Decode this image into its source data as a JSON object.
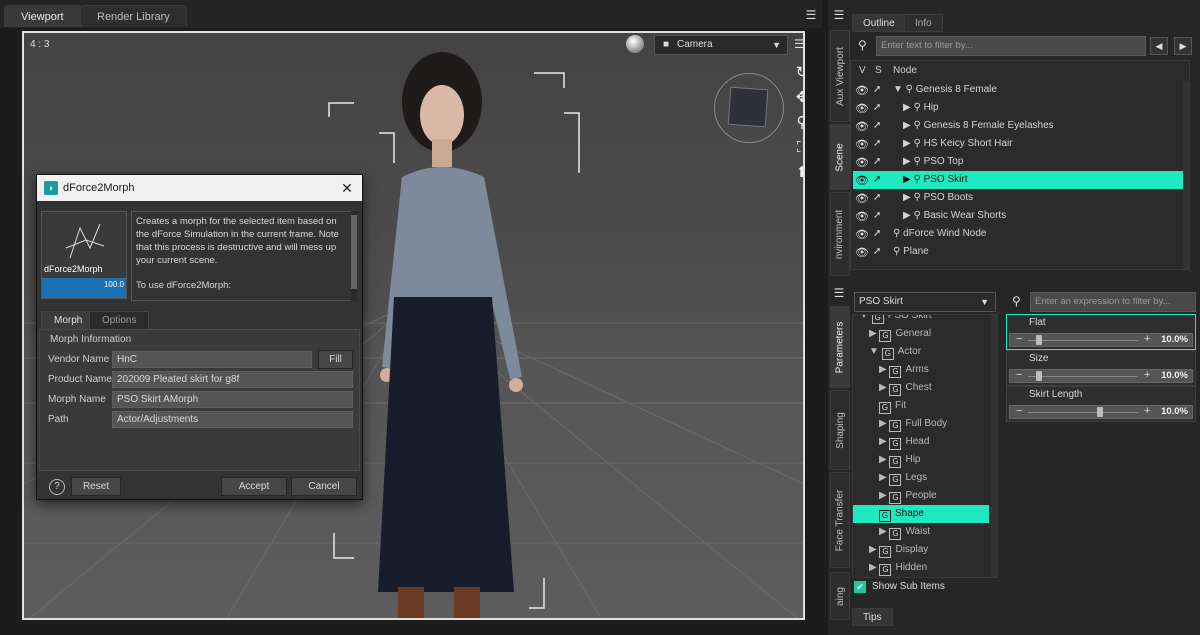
{
  "tabs": {
    "viewport": "Viewport",
    "render_library": "Render Library"
  },
  "viewport": {
    "aspect": "4 : 3",
    "camera": "Camera"
  },
  "dialog": {
    "title": "dForce2Morph",
    "thumb_label": "dForce2Morph",
    "thumb_value": "100.0",
    "description": [
      "Creates a morph for the selected item based on the dForce Simulation in the current frame. Note that this process is destructive and will mess up your current scene.",
      "To use dForce2Morph:"
    ],
    "tabs": [
      "Morph",
      "Options"
    ],
    "section": "Morph Information",
    "fields": [
      {
        "label": "Vendor Name",
        "value": "HnC"
      },
      {
        "label": "Product Name",
        "value": "202009 Pleated skirt for g8f"
      },
      {
        "label": "Morph Name",
        "value": "PSO Skirt AMorph"
      },
      {
        "label": "Path",
        "value": "Actor/Adjustments"
      }
    ],
    "fill": "Fill",
    "help": "?",
    "reset": "Reset",
    "accept": "Accept",
    "cancel": "Cancel"
  },
  "side_tabs_top": [
    "Aux Viewport",
    "Scene",
    "nvironment"
  ],
  "side_tabs_bottom": [
    "Parameters",
    "Shaping",
    "Face Transfer",
    "aing"
  ],
  "scene": {
    "tabs": [
      "Outline",
      "Info"
    ],
    "filter_placeholder": "Enter text to filter by...",
    "columns": {
      "v": "V",
      "s": "S",
      "node": "Node"
    },
    "nodes": [
      {
        "name": "Genesis 8 Female",
        "indent": 0,
        "arrow": "▼",
        "selected": false
      },
      {
        "name": "Hip",
        "indent": 1,
        "arrow": "▶",
        "selected": false
      },
      {
        "name": "Genesis 8 Female Eyelashes",
        "indent": 1,
        "arrow": "▶",
        "selected": false
      },
      {
        "name": "HS Keicy Short Hair",
        "indent": 1,
        "arrow": "▶",
        "selected": false
      },
      {
        "name": "PSO Top",
        "indent": 1,
        "arrow": "▶",
        "selected": false
      },
      {
        "name": "PSO Skirt",
        "indent": 1,
        "arrow": "▶",
        "selected": true
      },
      {
        "name": "PSO Boots",
        "indent": 1,
        "arrow": "▶",
        "selected": false
      },
      {
        "name": "Basic Wear Shorts",
        "indent": 1,
        "arrow": "▶",
        "selected": false
      },
      {
        "name": "dForce Wind Node",
        "indent": 0,
        "arrow": "",
        "selected": false
      },
      {
        "name": "Plane",
        "indent": 0,
        "arrow": "",
        "selected": false
      }
    ]
  },
  "parameters": {
    "node_select": "PSO Skirt",
    "filter_placeholder": "Enter an expression to filter by...",
    "tree": [
      {
        "label": "PSO Skirt",
        "indent": 0,
        "arrow": "▼",
        "selected": false
      },
      {
        "label": "General",
        "indent": 1,
        "arrow": "▶",
        "selected": false
      },
      {
        "label": "Actor",
        "indent": 1,
        "arrow": "▼",
        "selected": false
      },
      {
        "label": "Arms",
        "indent": 2,
        "arrow": "▶",
        "selected": false
      },
      {
        "label": "Chest",
        "indent": 2,
        "arrow": "▶",
        "selected": false
      },
      {
        "label": "Fit",
        "indent": 2,
        "arrow": "",
        "selected": false
      },
      {
        "label": "Full Body",
        "indent": 2,
        "arrow": "▶",
        "selected": false
      },
      {
        "label": "Head",
        "indent": 2,
        "arrow": "▶",
        "selected": false
      },
      {
        "label": "Hip",
        "indent": 2,
        "arrow": "▶",
        "selected": false
      },
      {
        "label": "Legs",
        "indent": 2,
        "arrow": "▶",
        "selected": false
      },
      {
        "label": "People",
        "indent": 2,
        "arrow": "▶",
        "selected": false
      },
      {
        "label": "Shape",
        "indent": 2,
        "arrow": "",
        "selected": true
      },
      {
        "label": "Waist",
        "indent": 2,
        "arrow": "▶",
        "selected": false
      },
      {
        "label": "Display",
        "indent": 1,
        "arrow": "▶",
        "selected": false
      },
      {
        "label": "Hidden",
        "indent": 1,
        "arrow": "▶",
        "selected": false
      }
    ],
    "show_sub_items": "Show Sub Items",
    "sliders": [
      {
        "label": "Flat",
        "value_text": "10.0%",
        "fraction": 0.1
      },
      {
        "label": "Size",
        "value_text": "10.0%",
        "fraction": 0.1
      },
      {
        "label": "Skirt Length",
        "value_text": "10.0%",
        "fraction": 0.65
      }
    ]
  },
  "tips": "Tips",
  "colors": {
    "accent": "#20e8c0",
    "viewport_frame": "#e0e0e0"
  }
}
